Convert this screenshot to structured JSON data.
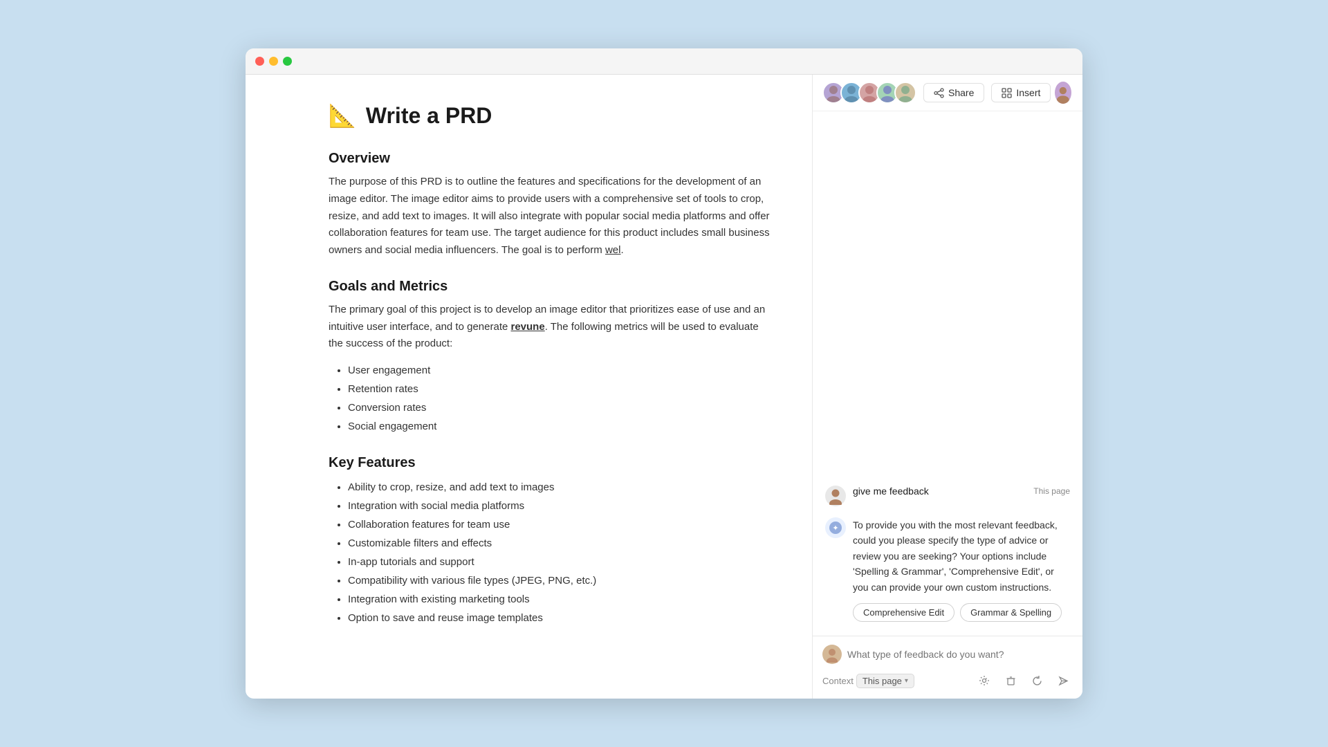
{
  "window": {
    "title": "Write a PRD"
  },
  "traffic_lights": {
    "red": "close",
    "yellow": "minimize",
    "green": "maximize"
  },
  "toolbar": {
    "share_label": "Share",
    "insert_label": "Insert"
  },
  "document": {
    "emoji": "📐",
    "title": "Write a PRD",
    "sections": [
      {
        "heading": "Overview",
        "content": [
          {
            "type": "paragraph",
            "text": "The purpose of this PRD is to outline the features and specifications for the development of an image editor. The image editor aims to provide users with a comprehensive set of tools to crop, resize, and add text to images. It will also integrate with popular social media platforms and offer collaboration features for team use. The target audience for this product includes small business owners and social media influencers. The goal is to perform ",
            "highlight": "wel",
            "after": "."
          }
        ]
      },
      {
        "heading": "Goals and Metrics",
        "content": [
          {
            "type": "paragraph_with_bold",
            "before": "The primary goal of this project is to develop an image editor that prioritizes ease of use and an intuitive user interface, and to generate ",
            "bold_underline": "revune",
            "after": ". The following metrics will be used to evaluate the success of the product:"
          },
          {
            "type": "bullets",
            "items": [
              "User engagement",
              "Retention rates",
              "Conversion rates",
              "Social engagement"
            ]
          }
        ]
      },
      {
        "heading": "Key Features",
        "content": [
          {
            "type": "bullets",
            "items": [
              "Ability to crop, resize, and add text to images",
              "Integration with social media platforms",
              "Collaboration features for team use",
              "Customizable filters and effects",
              "In-app tutorials and support",
              "Compatibility with various file types (JPEG, PNG, etc.)",
              "Integration with existing marketing tools",
              "Option to save and reuse image templates"
            ]
          }
        ]
      }
    ]
  },
  "ai_panel": {
    "messages": [
      {
        "role": "user",
        "avatar": "👤",
        "text": "give me feedback",
        "context": "This page"
      },
      {
        "role": "ai",
        "avatar": "🤖",
        "text": "To provide you with the most relevant feedback, could you please specify the type of advice or review you are seeking? Your options include 'Spelling & Grammar', 'Comprehensive Edit', or you can provide your own custom instructions.",
        "buttons": [
          "Comprehensive Edit",
          "Grammar & Spelling"
        ]
      }
    ],
    "input": {
      "placeholder": "What type of feedback do you want?",
      "context_label": "Context",
      "context_value": "This page"
    },
    "icons": {
      "settings": "⚙",
      "trash": "🗑",
      "refresh": "↺",
      "send": "➤"
    }
  }
}
